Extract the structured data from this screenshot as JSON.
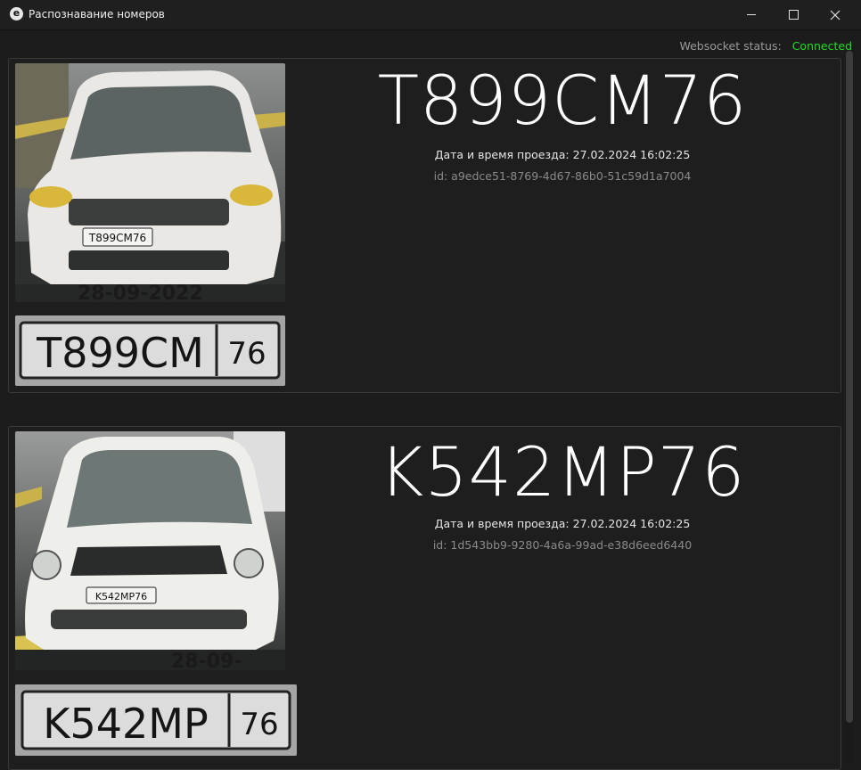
{
  "window": {
    "icon_letter": "e",
    "title": "Распознавание номеров"
  },
  "status": {
    "label": "Websocket status:",
    "value": "Connected",
    "value_color": "#22dd22"
  },
  "records": [
    {
      "plate": "T899CM76",
      "passage": "Дата и время проезда: 27.02.2024 16:02:25",
      "id": "id: a9edce51-8769-4d67-86b0-51c59d1a7004",
      "photo_plate_text": "T899CM76",
      "photo_timestamp": "28-09-2022",
      "crop_text_main": "T899CM",
      "crop_text_region": "76"
    },
    {
      "plate": "K542MP76",
      "passage": "Дата и время проезда: 27.02.2024 16:02:25",
      "id": "id: 1d543bb9-9280-4a6a-99ad-e38d6eed6440",
      "photo_plate_text": "K542MP76",
      "photo_timestamp": "28-09-",
      "crop_text_main": "K542MP",
      "crop_text_region": "76"
    }
  ]
}
